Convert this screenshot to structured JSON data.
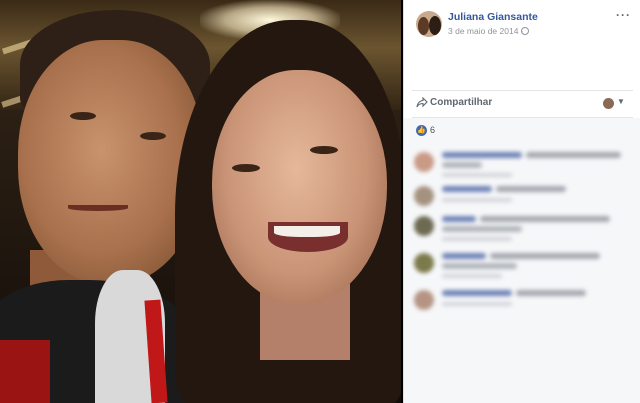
{
  "post": {
    "author": "Juliana Giansante",
    "date": "3 de maio de 2014 ·",
    "privacy_icon": "globe-icon",
    "more_label": "···"
  },
  "actions": {
    "share_label": "Compartilhar",
    "share_icon": "share-arrow-icon"
  },
  "reactions": {
    "like_icon": "thumbs-up-icon",
    "count": "6"
  },
  "comments_blurred": true,
  "colors": {
    "author_link": "#365899",
    "like_blue": "#4267b2",
    "panel_bg": "#ffffff",
    "comments_bg": "#f6f7f9"
  }
}
